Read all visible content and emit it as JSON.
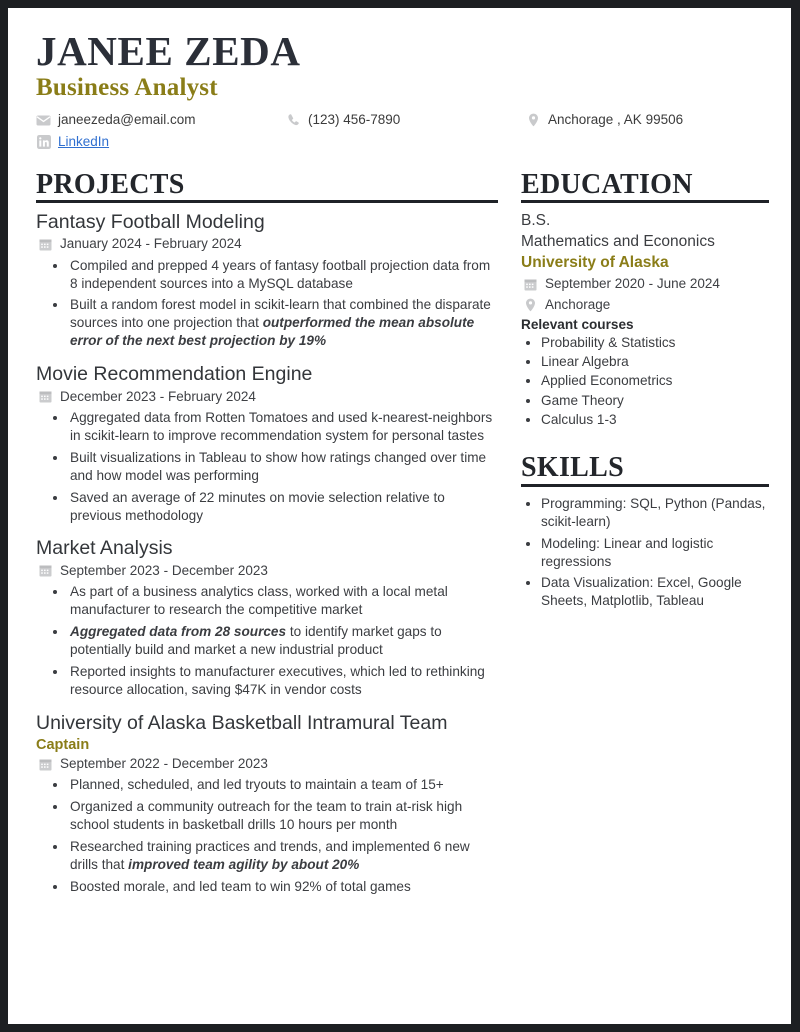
{
  "header": {
    "name": "JANEE ZEDA",
    "role": "Business Analyst",
    "email": "janeezeda@email.com",
    "phone": "(123) 456-7890",
    "location": "Anchorage , AK 99506",
    "linkedin_label": "LinkedIn",
    "icons": {
      "email": "envelope-icon",
      "phone": "phone-icon",
      "location": "map-pin-icon",
      "linkedin": "linkedin-icon"
    }
  },
  "colors": {
    "accent": "#8a7d18",
    "name": "#2b2f38",
    "text": "#3b3d41",
    "link": "#2f6fd0",
    "rule": "#1f2227",
    "page_border": "#1d1f22"
  },
  "projects": {
    "title": "PROJECTS",
    "entries": [
      {
        "title": "Fantasy Football Modeling",
        "dates": "January 2024 - February 2024",
        "bullets": [
          {
            "text": "Compiled and prepped 4 years of fantasy football projection data from 8 independent sources into a MySQL database"
          },
          {
            "text": "Built a random forest model in scikit-learn that combined the disparate sources into one projection that ",
            "emphasis": "outperformed the mean absolute error of the next best projection by 19%",
            "emphasis_position": "end"
          }
        ]
      },
      {
        "title": "Movie Recommendation Engine",
        "dates": "December 2023 - February 2024",
        "bullets": [
          {
            "text": "Aggregated data from Rotten Tomatoes and used k-nearest-neighbors in scikit-learn to improve recommendation system for personal tastes"
          },
          {
            "text": "Built visualizations in Tableau to show how ratings changed over time and how model was performing"
          },
          {
            "text": "Saved an average of 22 minutes on movie selection relative to previous methodology"
          }
        ]
      },
      {
        "title": "Market Analysis",
        "dates": "September 2023 - December 2023",
        "bullets": [
          {
            "text": "As part of a business analytics class, worked with a local metal manufacturer to research the competitive market"
          },
          {
            "emphasis": "Aggregated data from 28 sources",
            "text": " to identify market gaps to potentially build and market a new industrial product",
            "emphasis_position": "start"
          },
          {
            "text": "Reported insights to manufacturer executives, which led to rethinking resource allocation, saving $47K in vendor costs"
          }
        ]
      },
      {
        "title": "University of Alaska Basketball Intramural Team",
        "subtitle": "Captain",
        "dates": "September 2022 - December 2023",
        "bullets": [
          {
            "text": "Planned, scheduled, and led tryouts to maintain a team of 15+"
          },
          {
            "text": "Organized a community outreach for the team to train at-risk high school students in basketball drills 10 hours per month"
          },
          {
            "text": "Researched training practices and trends, and implemented 6 new drills that ",
            "emphasis": "improved team agility by about 20%",
            "emphasis_position": "end"
          },
          {
            "text": "Boosted morale, and led team to win 92% of total games"
          }
        ]
      }
    ]
  },
  "education": {
    "title": "EDUCATION",
    "degree": "B.S.",
    "field": "Mathematics and Econonics",
    "school": "University of Alaska",
    "dates": "September 2020 - June 2024",
    "location": "Anchorage",
    "courses_label": "Relevant courses",
    "courses": [
      "Probability & Statistics",
      "Linear Algebra",
      "Applied Econometrics",
      "Game Theory",
      "Calculus 1-3"
    ]
  },
  "skills": {
    "title": "SKILLS",
    "items": [
      "Programming: SQL, Python (Pandas, scikit-learn)",
      "Modeling: Linear and logistic regressions",
      "Data Visualization: Excel, Google Sheets, Matplotlib, Tableau"
    ]
  }
}
